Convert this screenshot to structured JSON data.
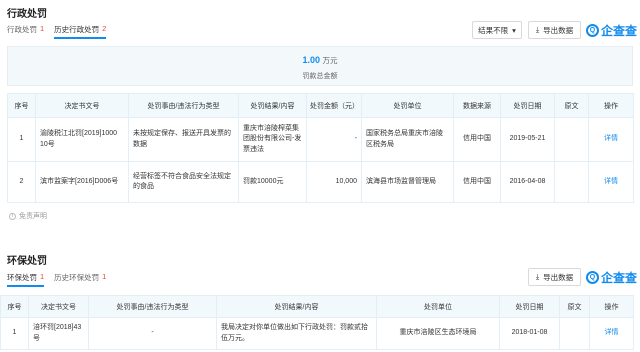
{
  "admin": {
    "title": "行政处罚",
    "tabs": [
      {
        "label": "行政处罚",
        "count": "1"
      },
      {
        "label": "历史行政处罚",
        "count": "2"
      }
    ],
    "filter_label": "结果不限",
    "export_label": "导出数据",
    "brand_text": "企查查",
    "brand_logo": "Q",
    "summary": {
      "amount": "1.00",
      "unit": "万元",
      "label": "罚款总金额"
    },
    "columns": [
      "序号",
      "决定书文号",
      "处罚事由/违法行为类型",
      "处罚结果/内容",
      "处罚金额（元）",
      "处罚单位",
      "数据来源",
      "处罚日期",
      "原文",
      "操作"
    ],
    "rows": [
      {
        "no": "1",
        "doc": "渝陵税江北罚[2019]1000 10号",
        "reason": "未按规定保存、报送开具发票的数据",
        "result": "重庆市涪陵榨菜集团股份有限公司-发票违法",
        "amount": "-",
        "unit": "国家税务总局重庆市涪陵区税务局",
        "source": "信用中国",
        "date": "2019-05-21",
        "original": "",
        "action": "详情"
      },
      {
        "no": "2",
        "doc": "滨市监案字[2016]D006号",
        "reason": "经营标签不符合食品安全法规定的食品",
        "result": "罚款10000元",
        "amount": "10,000",
        "unit": "滨海县市场监督管理局",
        "source": "信用中国",
        "date": "2016-04-08",
        "original": "",
        "action": "详情"
      }
    ],
    "disclaimer": "免责声明",
    "disclaimer_icon": "i"
  },
  "env": {
    "title": "环保处罚",
    "tabs": [
      {
        "label": "环保处罚",
        "count": "1"
      },
      {
        "label": "历史环保处罚",
        "count": "1"
      }
    ],
    "export_label": "导出数据",
    "brand_text": "企查查",
    "brand_logo": "Q",
    "columns": [
      "序号",
      "决定书文号",
      "处罚事由/违法行为类型",
      "处罚结果/内容",
      "处罚单位",
      "处罚日期",
      "原文",
      "操作"
    ],
    "rows": [
      {
        "no": "1",
        "doc": "涪环罚[2018]43号",
        "reason": "-",
        "result": "我局决定对你单位做出如下行政处罚：罚款贰拾伍万元。",
        "unit": "重庆市涪陵区生态环境局",
        "date": "2018-01-08",
        "original": "",
        "action": "详情"
      }
    ]
  }
}
